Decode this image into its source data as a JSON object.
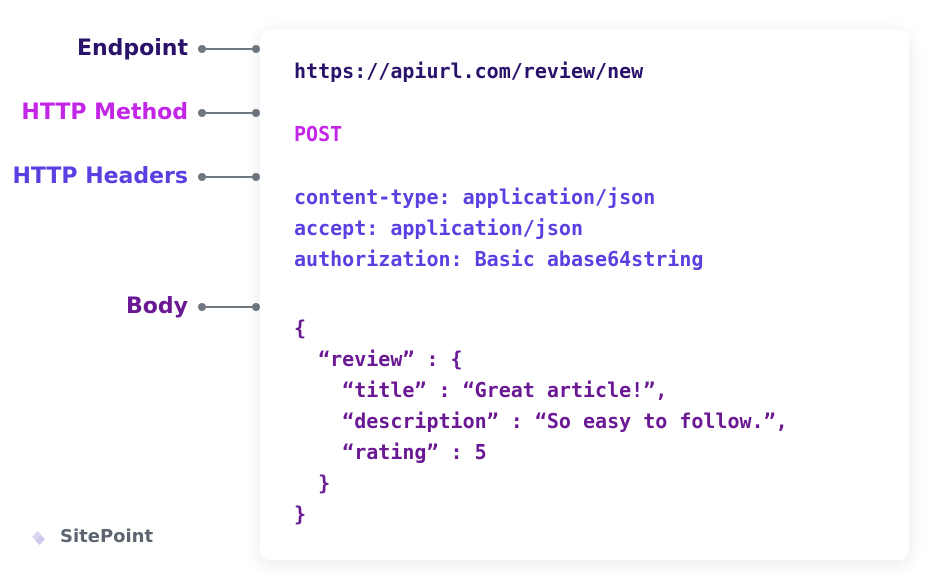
{
  "labels": {
    "endpoint": "Endpoint",
    "method": "HTTP Method",
    "headers": "HTTP Headers",
    "body": "Body"
  },
  "request": {
    "endpoint": "https://apiurl.com/review/new",
    "method": "POST",
    "headers": {
      "line1": "content-type: application/json",
      "line2": "accept: application/json",
      "line3": "authorization: Basic abase64string"
    },
    "body_text": "{\n  “review” : {\n    “title” : “Great article!”,\n    “description” : “So easy to follow.”,\n    “rating” : 5\n  }\n}"
  },
  "footer": {
    "brand": "SitePoint"
  },
  "colors": {
    "endpoint": "#2a1169",
    "method": "#c326e6",
    "headers": "#5b3fe0",
    "body": "#6b1894",
    "connector": "#6f7780"
  }
}
